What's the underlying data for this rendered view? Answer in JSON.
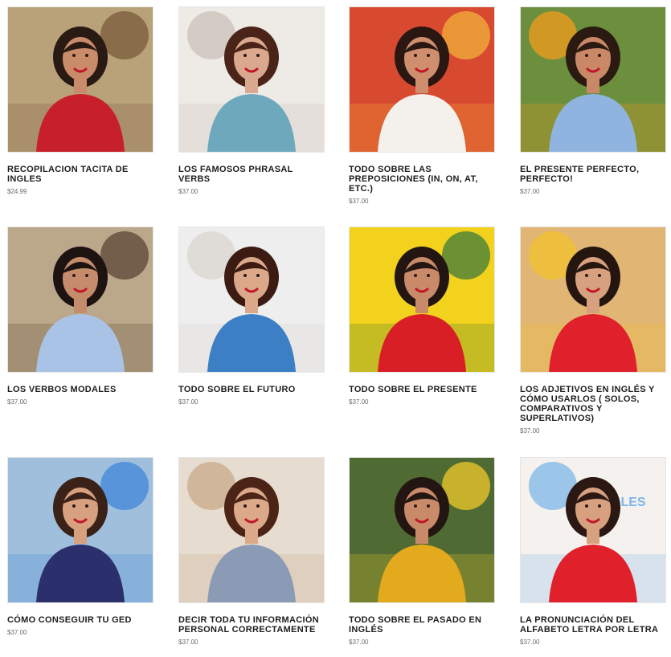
{
  "products": [
    {
      "title": "RECOPILACION TACITA DE INGLES",
      "price": "$24.99",
      "colors": {
        "bg": "#b9a27a",
        "accent": "#7a5a3a",
        "shirt": "#c8202b",
        "hair": "#2a1a14",
        "skin": "#c98b6a"
      }
    },
    {
      "title": "LOS FAMOSOS PHRASAL VERBS",
      "price": "$37.00",
      "colors": {
        "bg": "#eeeae6",
        "accent": "#c9c0b8",
        "shirt": "#6ea8bd",
        "hair": "#4a2418",
        "skin": "#d9a88e"
      }
    },
    {
      "title": "TODO SOBRE LAS PREPOSICIONES (IN, ON, AT, ETC.)",
      "price": "$37.00",
      "colors": {
        "bg": "#d84a2f",
        "accent": "#f2b23b",
        "shirt": "#f4f1ec",
        "hair": "#2a1712",
        "skin": "#cf8e6e"
      }
    },
    {
      "title": "EL PRESENTE PERFECTO, PERFECTO!",
      "price": "$37.00",
      "colors": {
        "bg": "#6c8f3e",
        "accent": "#f39b1c",
        "shirt": "#8fb4e0",
        "hair": "#2b1a12",
        "skin": "#c98866"
      }
    },
    {
      "title": "LOS VERBOS MODALES",
      "price": "$37.00",
      "colors": {
        "bg": "#bba789",
        "accent": "#5a4636",
        "shirt": "#a9c3e6",
        "hair": "#1d1311",
        "skin": "#c58c6c"
      }
    },
    {
      "title": "TODO SOBRE EL FUTURO",
      "price": "$37.00",
      "colors": {
        "bg": "#eeeeee",
        "accent": "#d9d5cf",
        "shirt": "#3c7fc4",
        "hair": "#3b1b12",
        "skin": "#dba88a"
      }
    },
    {
      "title": "TODO SOBRE EL PRESENTE",
      "price": "$37.00",
      "colors": {
        "bg": "#f2d21d",
        "accent": "#3f7b3a",
        "shirt": "#d81f26",
        "hair": "#231512",
        "skin": "#c98a6a"
      }
    },
    {
      "title": "LOS ADJETIVOS EN INGLÉS Y CÓMO USARLOS ( SOLOS, COMPARATIVOS Y SUPERLATIVOS)",
      "price": "$37.00",
      "colors": {
        "bg": "#e1b674",
        "accent": "#f2c12e",
        "shirt": "#e0202b",
        "hair": "#24150f",
        "skin": "#d7a07e"
      }
    },
    {
      "title": "CÓMO CONSEGUIR TU GED",
      "price": "$37.00",
      "colors": {
        "bg": "#9fbfdc",
        "accent": "#3f86d9",
        "shirt": "#2b2f6b",
        "hair": "#3a2218",
        "skin": "#d7a07e"
      }
    },
    {
      "title": "DECIR TODA TU INFORMACIÓN PERSONAL CORRECTAMENTE",
      "price": "$37.00",
      "colors": {
        "bg": "#e6dccf",
        "accent": "#c8a98a",
        "shirt": "#8c9bb5",
        "hair": "#4b2416",
        "skin": "#dba88a"
      }
    },
    {
      "title": "TODO SOBRE EL PASADO EN INGLÉS",
      "price": "$37.00",
      "colors": {
        "bg": "#4f6b33",
        "accent": "#f0c829",
        "shirt": "#e3aa1d",
        "hair": "#231512",
        "skin": "#c98a6a"
      }
    },
    {
      "title": "LA PRONUNCIACIÓN DEL ALFABETO LETRA POR LETRA",
      "price": "$37.00",
      "colors": {
        "bg": "#f4f1ee",
        "accent": "#7fb6e8",
        "shirt": "#e0202b",
        "hair": "#2b1812",
        "skin": "#d7a07e"
      }
    }
  ],
  "board_text": "INGLES"
}
